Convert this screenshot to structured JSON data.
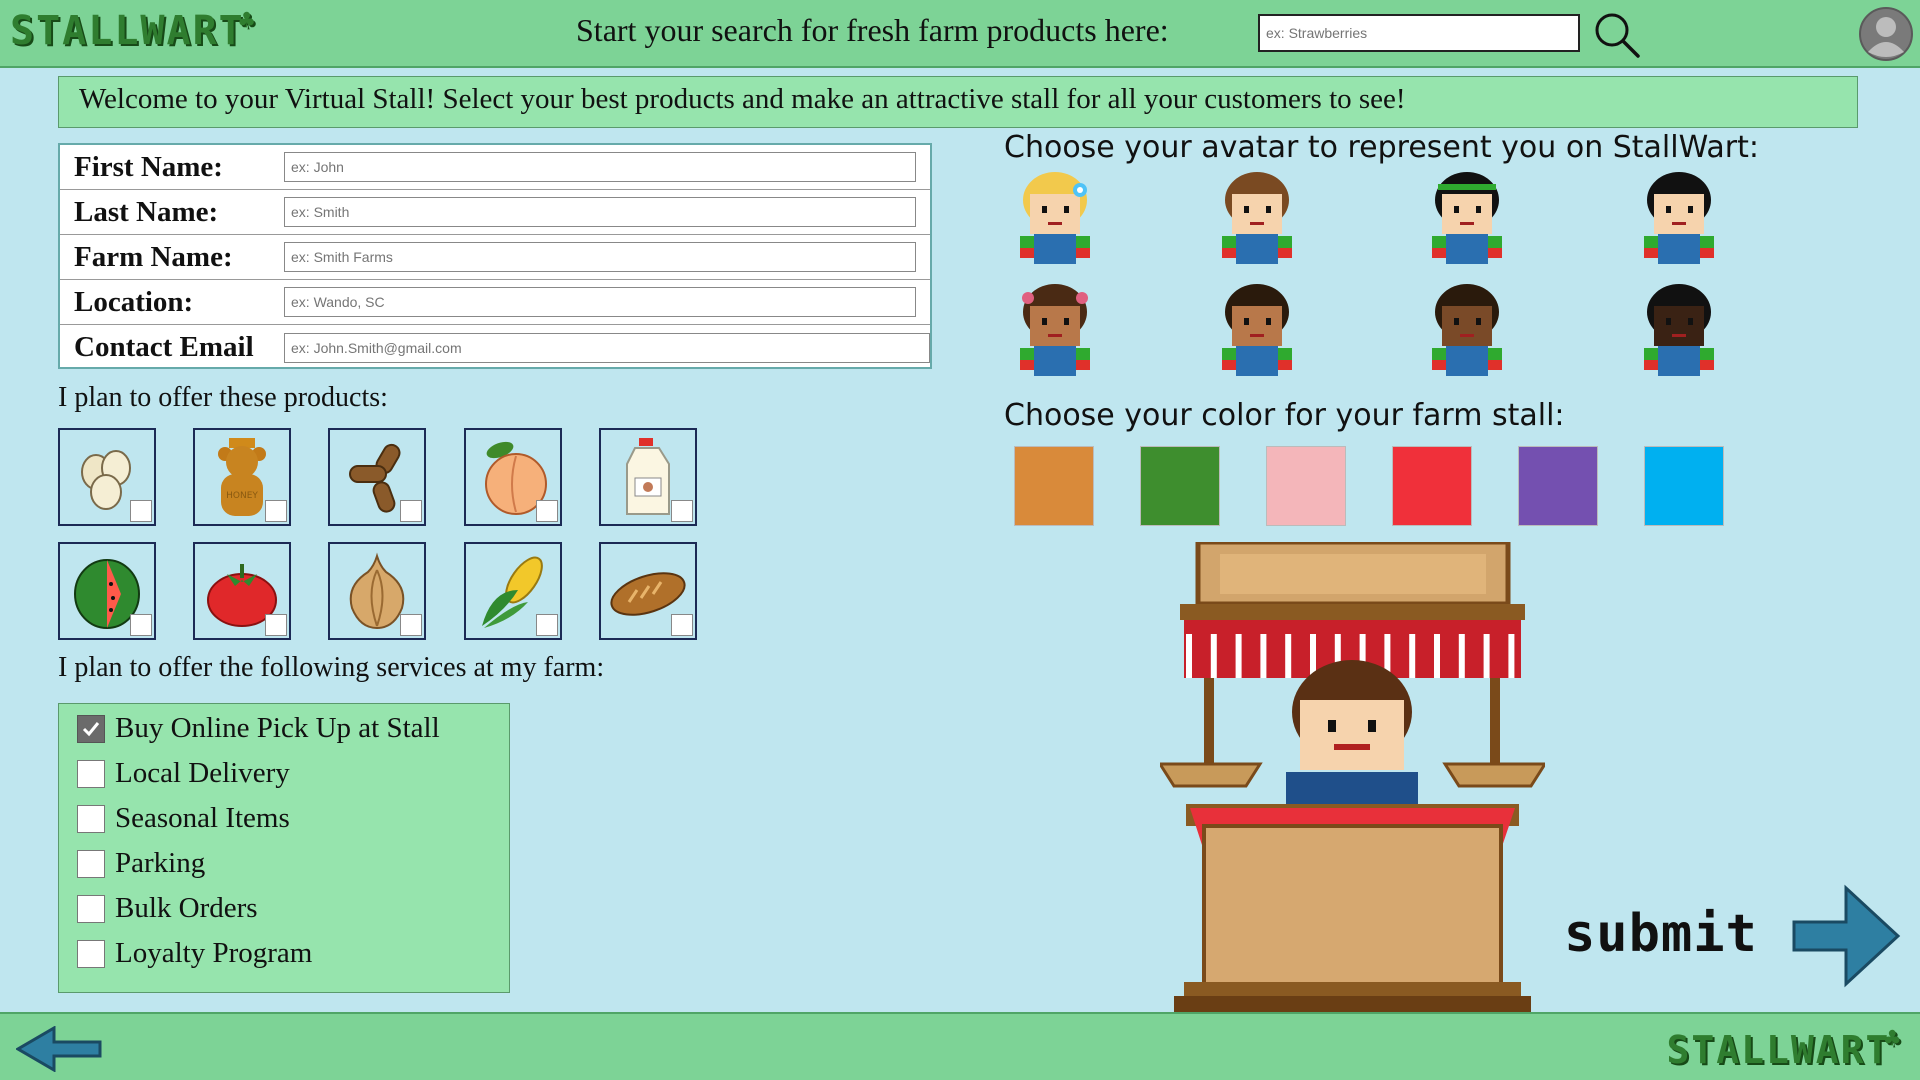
{
  "brand": {
    "name": "STALLWART"
  },
  "header": {
    "search_prompt": "Start your search for fresh farm products here:",
    "search_placeholder": "ex: Strawberries"
  },
  "welcome_text": "Welcome to your Virtual Stall! Select your best products and make an attractive stall for all your customers to see!",
  "form": {
    "fields": [
      {
        "label": "First Name:",
        "placeholder": "ex: John"
      },
      {
        "label": "Last Name:",
        "placeholder": "ex: Smith"
      },
      {
        "label": "Farm Name:",
        "placeholder": "ex: Smith Farms"
      },
      {
        "label": "Location:",
        "placeholder": "ex: Wando, SC"
      },
      {
        "label": "Contact Email",
        "placeholder": "ex: John.Smith@gmail.com"
      }
    ]
  },
  "products": {
    "label": "I plan to offer these products:",
    "items": [
      "eggs-icon",
      "honey-bear-icon",
      "peanuts-icon",
      "peach-icon",
      "milk-jug-icon",
      "watermelon-icon",
      "tomato-icon",
      "onion-icon",
      "corn-icon",
      "bread-icon"
    ]
  },
  "services": {
    "label": "I plan to offer the following services at my farm:",
    "items": [
      {
        "label": "Buy Online Pick Up at Stall",
        "checked": true
      },
      {
        "label": "Local Delivery",
        "checked": false
      },
      {
        "label": "Seasonal Items",
        "checked": false
      },
      {
        "label": "Parking",
        "checked": false
      },
      {
        "label": "Bulk Orders",
        "checked": false
      },
      {
        "label": "Loyalty Program",
        "checked": false
      }
    ]
  },
  "avatars": {
    "label": "Choose your avatar to represent you on StallWart:",
    "items": [
      {
        "hair": "#f2c94c",
        "skin": "#f6d3ad",
        "shirt": "#2a6fb0",
        "accessory": "flower"
      },
      {
        "hair": "#7a4a22",
        "skin": "#f6d3ad",
        "shirt": "#2a6fb0",
        "accessory": "none"
      },
      {
        "hair": "#111111",
        "skin": "#f6d3ad",
        "shirt": "#2a6fb0",
        "accessory": "headband"
      },
      {
        "hair": "#111111",
        "skin": "#f6d3ad",
        "shirt": "#2a6fb0",
        "accessory": "none"
      },
      {
        "hair": "#4a2a14",
        "skin": "#b8784a",
        "shirt": "#2a6fb0",
        "accessory": "bows"
      },
      {
        "hair": "#2a1a0c",
        "skin": "#b8784a",
        "shirt": "#2a6fb0",
        "accessory": "none"
      },
      {
        "hair": "#2a1a0c",
        "skin": "#7a4a28",
        "shirt": "#2a6fb0",
        "accessory": "none"
      },
      {
        "hair": "#111111",
        "skin": "#3a2214",
        "shirt": "#2a6fb0",
        "accessory": "none"
      }
    ]
  },
  "stall_colors": {
    "label": "Choose your color for your farm stall:",
    "swatches": [
      "#d98a3a",
      "#3e8e2e",
      "#f4b6ba",
      "#f0303a",
      "#7450b0",
      "#00b0f0"
    ]
  },
  "submit_label": "submit",
  "colors": {
    "header_bg": "#7dd396",
    "page_bg": "#bfe6ef",
    "panel_bg": "#96e4ad"
  }
}
